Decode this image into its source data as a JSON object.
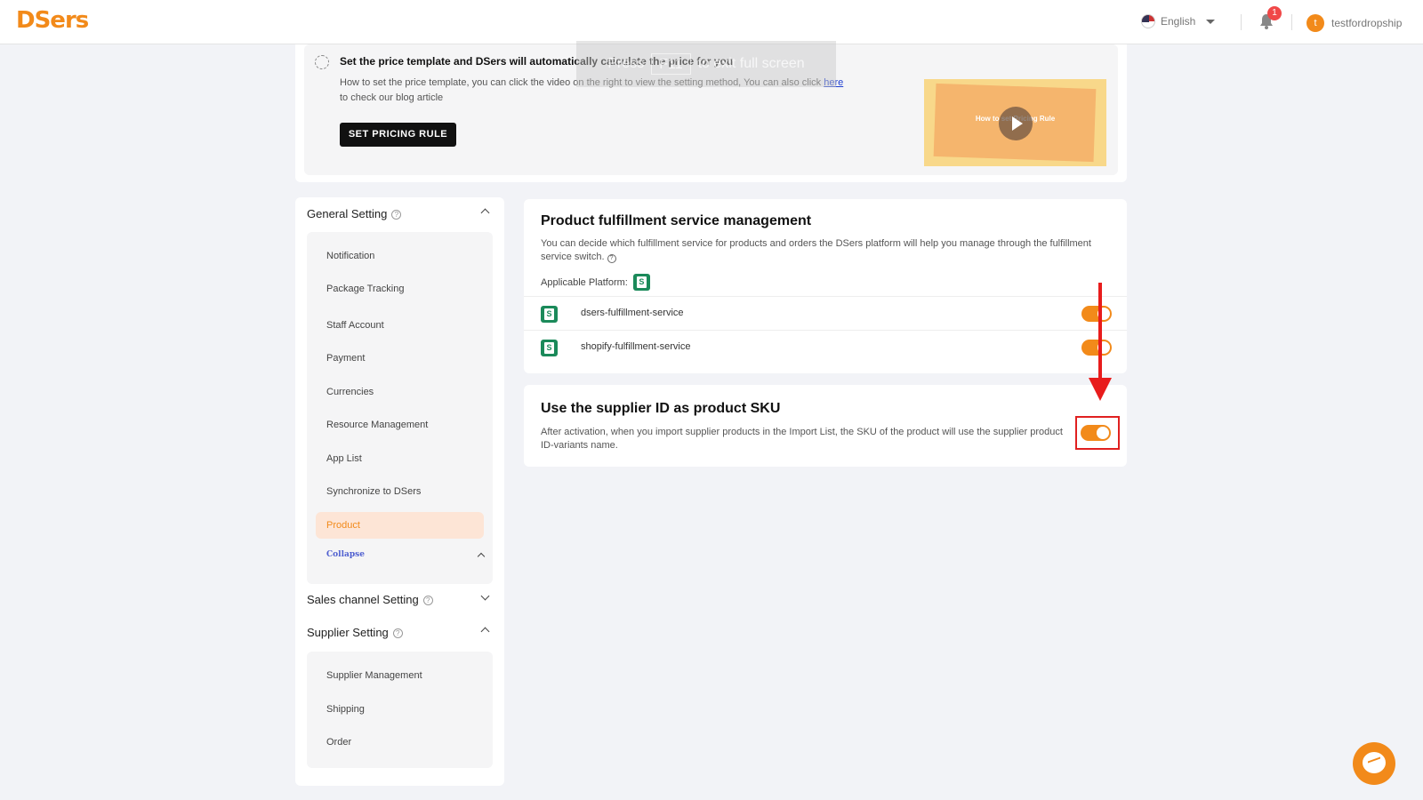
{
  "header": {
    "logo": "DSers",
    "language": "English",
    "notification_count": "1",
    "avatar_initial": "t",
    "username": "testfordropship"
  },
  "pricing": {
    "title": "Set the price template and DSers will automatically calculate the price for you",
    "desc_before_link": "How to set the price template, you can click the video on the right to view the setting method, You can also click ",
    "link": "here",
    "desc_after_link": " to check our blog article",
    "button": "SET PRICING RULE",
    "overlay_text_1": "Press",
    "overlay_key": "F11",
    "overlay_text_2": "to exit full screen",
    "video_title": "How to set Pricing Rule"
  },
  "sidebar": {
    "general": {
      "title": "General Setting",
      "items": [
        "Notification",
        "Package Tracking",
        "Staff Account",
        "Payment",
        "Currencies",
        "Resource Management",
        "App List",
        "Synchronize to DSers",
        "Product"
      ],
      "collapse": "Collapse"
    },
    "sales": {
      "title": "Sales channel Setting"
    },
    "supplier": {
      "title": "Supplier Setting",
      "items": [
        "Supplier Management",
        "Shipping",
        "Order"
      ]
    }
  },
  "fulfillment": {
    "title": "Product fulfillment service management",
    "desc": "You can decide which fulfillment service for products and orders the DSers platform will help you manage through the fulfillment service switch.",
    "platform_label": "Applicable Platform:",
    "services": [
      {
        "name": "dsers-fulfillment-service",
        "enabled": true
      },
      {
        "name": "shopify-fulfillment-service",
        "enabled": true
      }
    ]
  },
  "sku": {
    "title": "Use the supplier ID as product SKU",
    "desc": "After activation, when you import supplier products in the Import List, the SKU of the product will use the supplier product ID-variants name.",
    "enabled": true
  },
  "colors": {
    "accent": "#f28a1a",
    "highlight": "#e02020"
  }
}
